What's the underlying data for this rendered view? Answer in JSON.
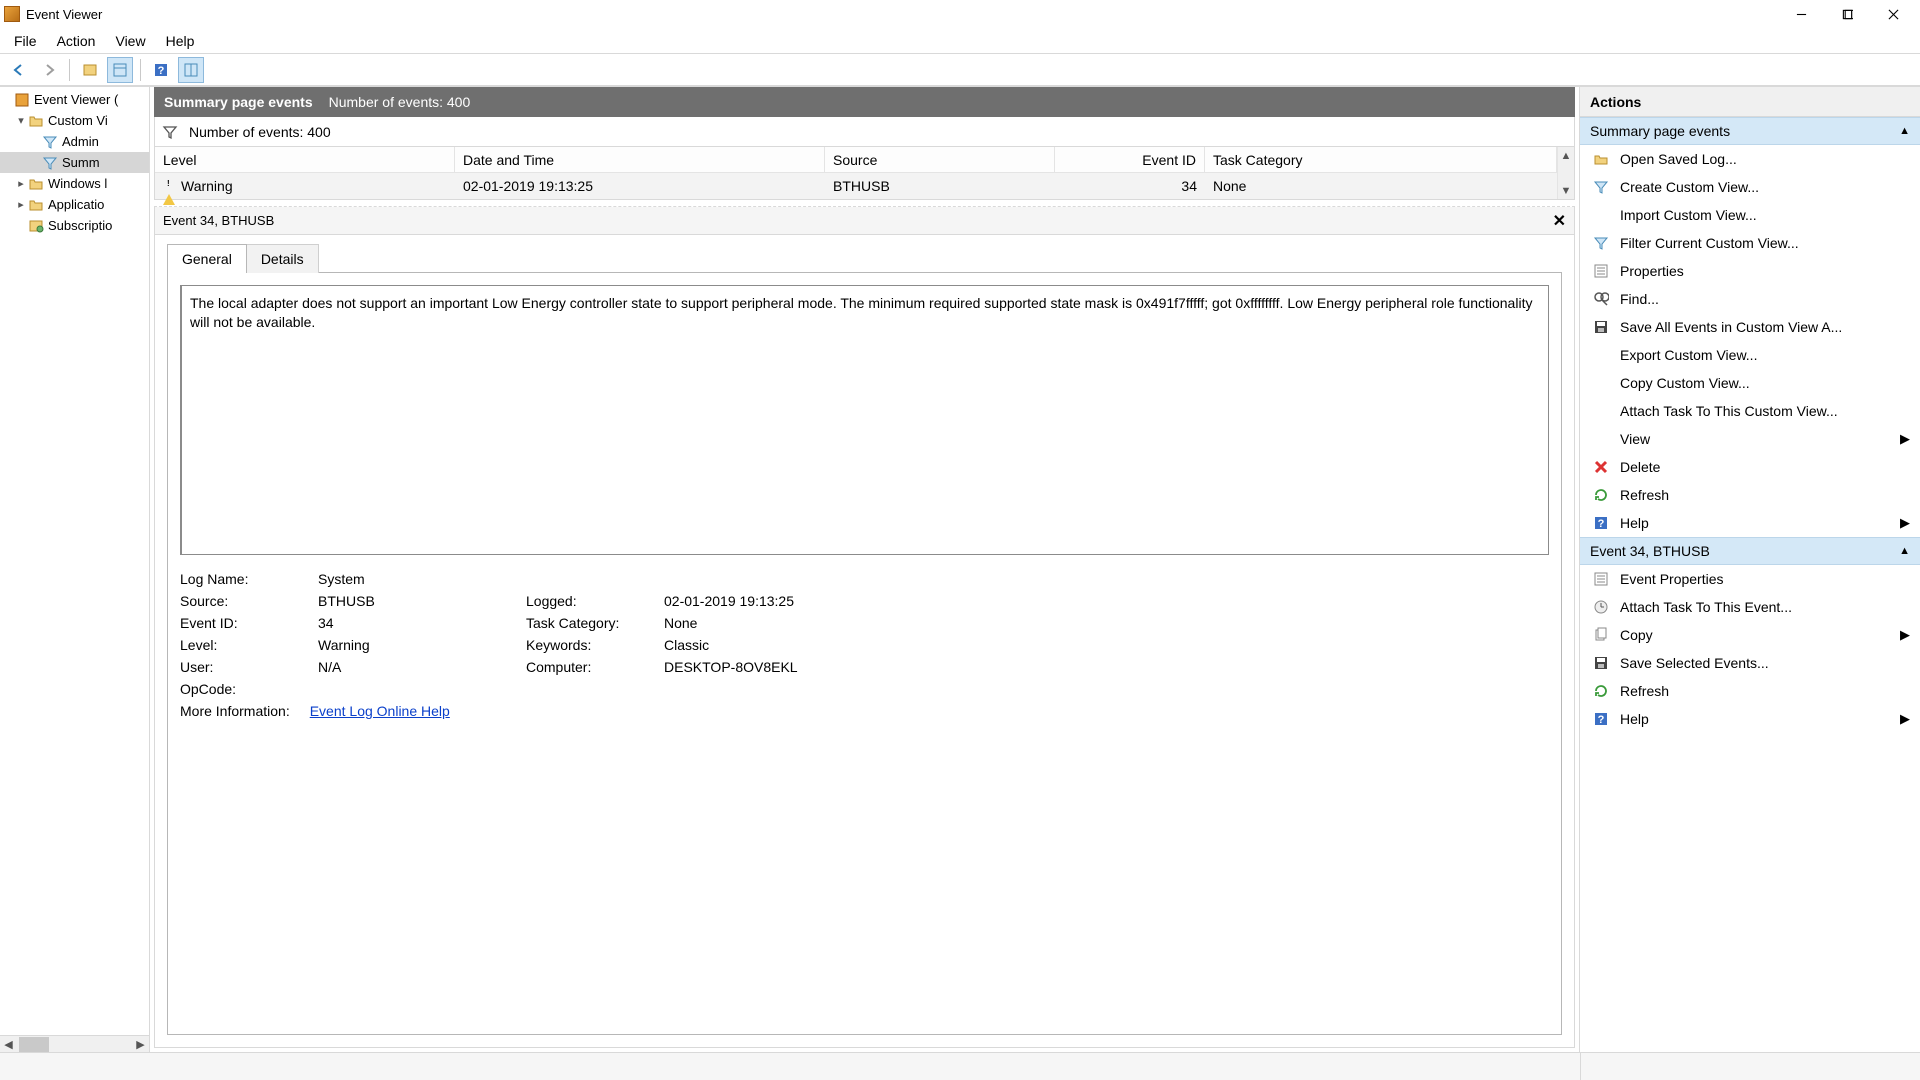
{
  "window": {
    "title": "Event Viewer"
  },
  "menubar": [
    "File",
    "Action",
    "View",
    "Help"
  ],
  "tree": {
    "root": "Event Viewer (",
    "items": [
      {
        "label": "Custom Vi",
        "indent": 1,
        "expander": "▾",
        "iconType": "folder"
      },
      {
        "label": "Admin",
        "indent": 2,
        "expander": "",
        "iconType": "filter"
      },
      {
        "label": "Summ",
        "indent": 2,
        "expander": "",
        "iconType": "filter",
        "selected": true
      },
      {
        "label": "Windows l",
        "indent": 1,
        "expander": "▸",
        "iconType": "folder"
      },
      {
        "label": "Applicatio",
        "indent": 1,
        "expander": "▸",
        "iconType": "folder"
      },
      {
        "label": "Subscriptio",
        "indent": 1,
        "expander": "",
        "iconType": "sub"
      }
    ]
  },
  "centerHeader": {
    "title": "Summary page events",
    "count": "Number of events: 400"
  },
  "filterBar": {
    "count": "Number of events: 400"
  },
  "columns": [
    "Level",
    "Date and Time",
    "Source",
    "Event ID",
    "Task Category"
  ],
  "row": {
    "level": "Warning",
    "datetime": "02-01-2019 19:13:25",
    "source": "BTHUSB",
    "eventId": "34",
    "task": "None"
  },
  "detail": {
    "header": "Event 34, BTHUSB",
    "tabs": {
      "general": "General",
      "details": "Details"
    },
    "description": "The local adapter does not support an important Low Energy controller state to support peripheral mode. The minimum required supported state mask is 0x491f7fffff; got 0xffffffff. Low Energy peripheral role functionality will not be available.",
    "logNameLabel": "Log Name:",
    "logName": "System",
    "sourceLabel": "Source:",
    "source": "BTHUSB",
    "loggedLabel": "Logged:",
    "logged": "02-01-2019 19:13:25",
    "eventIdLabel": "Event ID:",
    "eventId": "34",
    "taskCatLabel": "Task Category:",
    "taskCat": "None",
    "levelLabel": "Level:",
    "level": "Warning",
    "keywordsLabel": "Keywords:",
    "keywords": "Classic",
    "userLabel": "User:",
    "user": "N/A",
    "computerLabel": "Computer:",
    "computer": "DESKTOP-8OV8EKL",
    "opcodeLabel": "OpCode:",
    "opcode": "",
    "moreInfoLabel": "More Information:",
    "moreInfoLink": "Event Log Online Help"
  },
  "actions": {
    "title": "Actions",
    "section1": "Summary page events",
    "section2": "Event 34, BTHUSB",
    "items1": [
      {
        "icon": "open",
        "label": "Open Saved Log..."
      },
      {
        "icon": "filter",
        "label": "Create Custom View..."
      },
      {
        "icon": "",
        "label": "Import Custom View..."
      },
      {
        "icon": "filter",
        "label": "Filter Current Custom View..."
      },
      {
        "icon": "props",
        "label": "Properties"
      },
      {
        "icon": "find",
        "label": "Find..."
      },
      {
        "icon": "save",
        "label": "Save All Events in Custom View A..."
      },
      {
        "icon": "",
        "label": "Export Custom View..."
      },
      {
        "icon": "",
        "label": "Copy Custom View..."
      },
      {
        "icon": "",
        "label": "Attach Task To This Custom View..."
      },
      {
        "icon": "",
        "label": "View",
        "submenu": true
      },
      {
        "icon": "delete",
        "label": "Delete"
      },
      {
        "icon": "refresh",
        "label": "Refresh"
      },
      {
        "icon": "help",
        "label": "Help",
        "submenu": true
      }
    ],
    "items2": [
      {
        "icon": "props",
        "label": "Event Properties"
      },
      {
        "icon": "task",
        "label": "Attach Task To This Event..."
      },
      {
        "icon": "copy",
        "label": "Copy",
        "submenu": true
      },
      {
        "icon": "save",
        "label": "Save Selected Events..."
      },
      {
        "icon": "refresh",
        "label": "Refresh"
      },
      {
        "icon": "help",
        "label": "Help",
        "submenu": true
      }
    ]
  }
}
